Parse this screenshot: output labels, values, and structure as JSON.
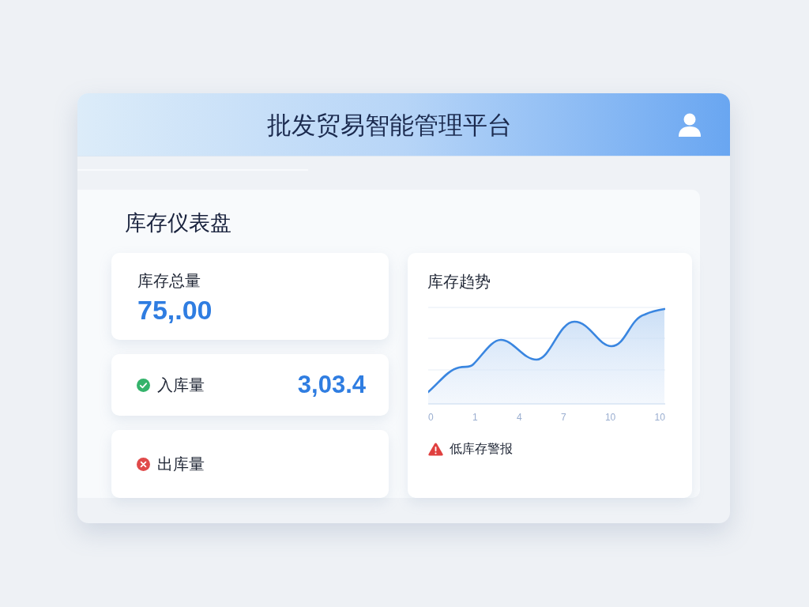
{
  "header": {
    "title": "批发贸易智能管理平台"
  },
  "dashboard": {
    "heading": "库存仪表盘"
  },
  "summary_cards": [
    {
      "kind": "total",
      "label": "库存总量",
      "value": "75,.00"
    },
    {
      "kind": "inbound",
      "label": "入库量",
      "value": "3,03.4"
    },
    {
      "kind": "outbound",
      "label": "出库量"
    }
  ],
  "trend_chart": {
    "title": "库存趋势",
    "axis_labels": [
      "0",
      "1",
      "4",
      "7",
      "10",
      "10"
    ],
    "alert": "低库存警报"
  }
}
